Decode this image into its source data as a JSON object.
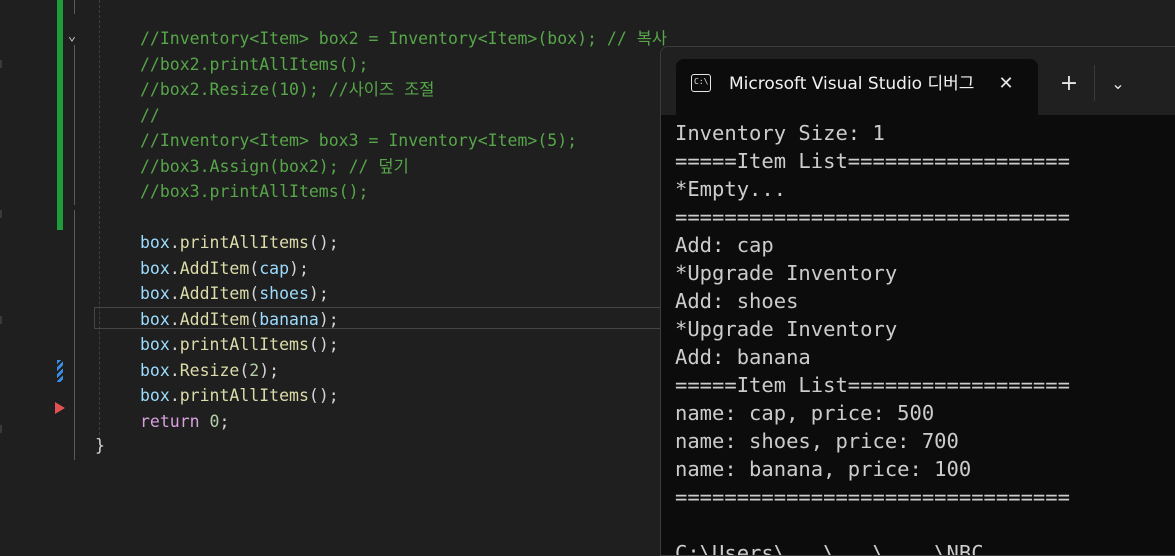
{
  "editor": {
    "code_lines": [
      [
        {
          "t": "//Inventory<Item> box2 = Inventory<Item>(box); // 복사",
          "c": "cm"
        }
      ],
      [
        {
          "t": "//box2.printAllItems();",
          "c": "cm"
        }
      ],
      [
        {
          "t": "//box2.Resize(10); //사이즈 조절",
          "c": "cm"
        }
      ],
      [
        {
          "t": "//",
          "c": "cm"
        }
      ],
      [
        {
          "t": "//Inventory<Item> box3 = Inventory<Item>(5);",
          "c": "cm"
        }
      ],
      [
        {
          "t": "//box3.Assign(box2); // 덮기",
          "c": "cm"
        }
      ],
      [
        {
          "t": "//box3.printAllItems();",
          "c": "cm"
        }
      ],
      [],
      [
        {
          "t": "box",
          "c": "id"
        },
        {
          "t": ".",
          "c": "pn"
        },
        {
          "t": "printAllItems",
          "c": "fn"
        },
        {
          "t": "();",
          "c": "pn"
        }
      ],
      [
        {
          "t": "box",
          "c": "id"
        },
        {
          "t": ".",
          "c": "pn"
        },
        {
          "t": "AddItem",
          "c": "fn"
        },
        {
          "t": "(",
          "c": "pn"
        },
        {
          "t": "cap",
          "c": "id"
        },
        {
          "t": ");",
          "c": "pn"
        }
      ],
      [
        {
          "t": "box",
          "c": "id"
        },
        {
          "t": ".",
          "c": "pn"
        },
        {
          "t": "AddItem",
          "c": "fn"
        },
        {
          "t": "(",
          "c": "pn"
        },
        {
          "t": "shoes",
          "c": "id"
        },
        {
          "t": ");",
          "c": "pn"
        }
      ],
      [
        {
          "t": "box",
          "c": "id"
        },
        {
          "t": ".",
          "c": "pn"
        },
        {
          "t": "AddItem",
          "c": "fn"
        },
        {
          "t": "(",
          "c": "pn"
        },
        {
          "t": "banana",
          "c": "id"
        },
        {
          "t": ");",
          "c": "pn"
        }
      ],
      [
        {
          "t": "box",
          "c": "id"
        },
        {
          "t": ".",
          "c": "pn"
        },
        {
          "t": "printAllItems",
          "c": "fn"
        },
        {
          "t": "();",
          "c": "pn"
        }
      ],
      [
        {
          "t": "box",
          "c": "id"
        },
        {
          "t": ".",
          "c": "pn"
        },
        {
          "t": "Resize",
          "c": "fn"
        },
        {
          "t": "(",
          "c": "pn"
        },
        {
          "t": "2",
          "c": "nm"
        },
        {
          "t": ");",
          "c": "pn"
        }
      ],
      [
        {
          "t": "box",
          "c": "id"
        },
        {
          "t": ".",
          "c": "pn"
        },
        {
          "t": "printAllItems",
          "c": "fn"
        },
        {
          "t": "();",
          "c": "pn"
        }
      ],
      [
        {
          "t": "return",
          "c": "kw"
        },
        {
          "t": " ",
          "c": "pn"
        },
        {
          "t": "0",
          "c": "nm"
        },
        {
          "t": ";",
          "c": "pn"
        }
      ]
    ],
    "closing_brace": "}",
    "fold_icon": "chevron-down-icon",
    "colors": {
      "comment": "#57a64a",
      "identifier": "#9cdcfe",
      "function": "#dcdcaa",
      "number": "#b5cea8",
      "keyword": "#d8a0df",
      "change_bar": "#1f9c3a",
      "breakpoint_arrow": "#e05252"
    }
  },
  "terminal": {
    "tab_title": "Microsoft Visual Studio 디버그",
    "tab_icon": "console-icon",
    "close_glyph": "✕",
    "new_tab_glyph": "+",
    "dropdown_glyph": "⌄",
    "output_lines": [
      "Inventory Size: 1",
      "=====Item List==================",
      "*Empty...",
      "================================",
      "Add: cap",
      "*Upgrade Inventory",
      "Add: shoes",
      "*Upgrade Inventory",
      "Add: banana",
      "=====Item List==================",
      "name: cap, price: 500",
      "name: shoes, price: 700",
      "name: banana, price: 100",
      "================================",
      ""
    ],
    "prompt_partial": "C:\\Users\\...\\...\\....\\NBC"
  }
}
